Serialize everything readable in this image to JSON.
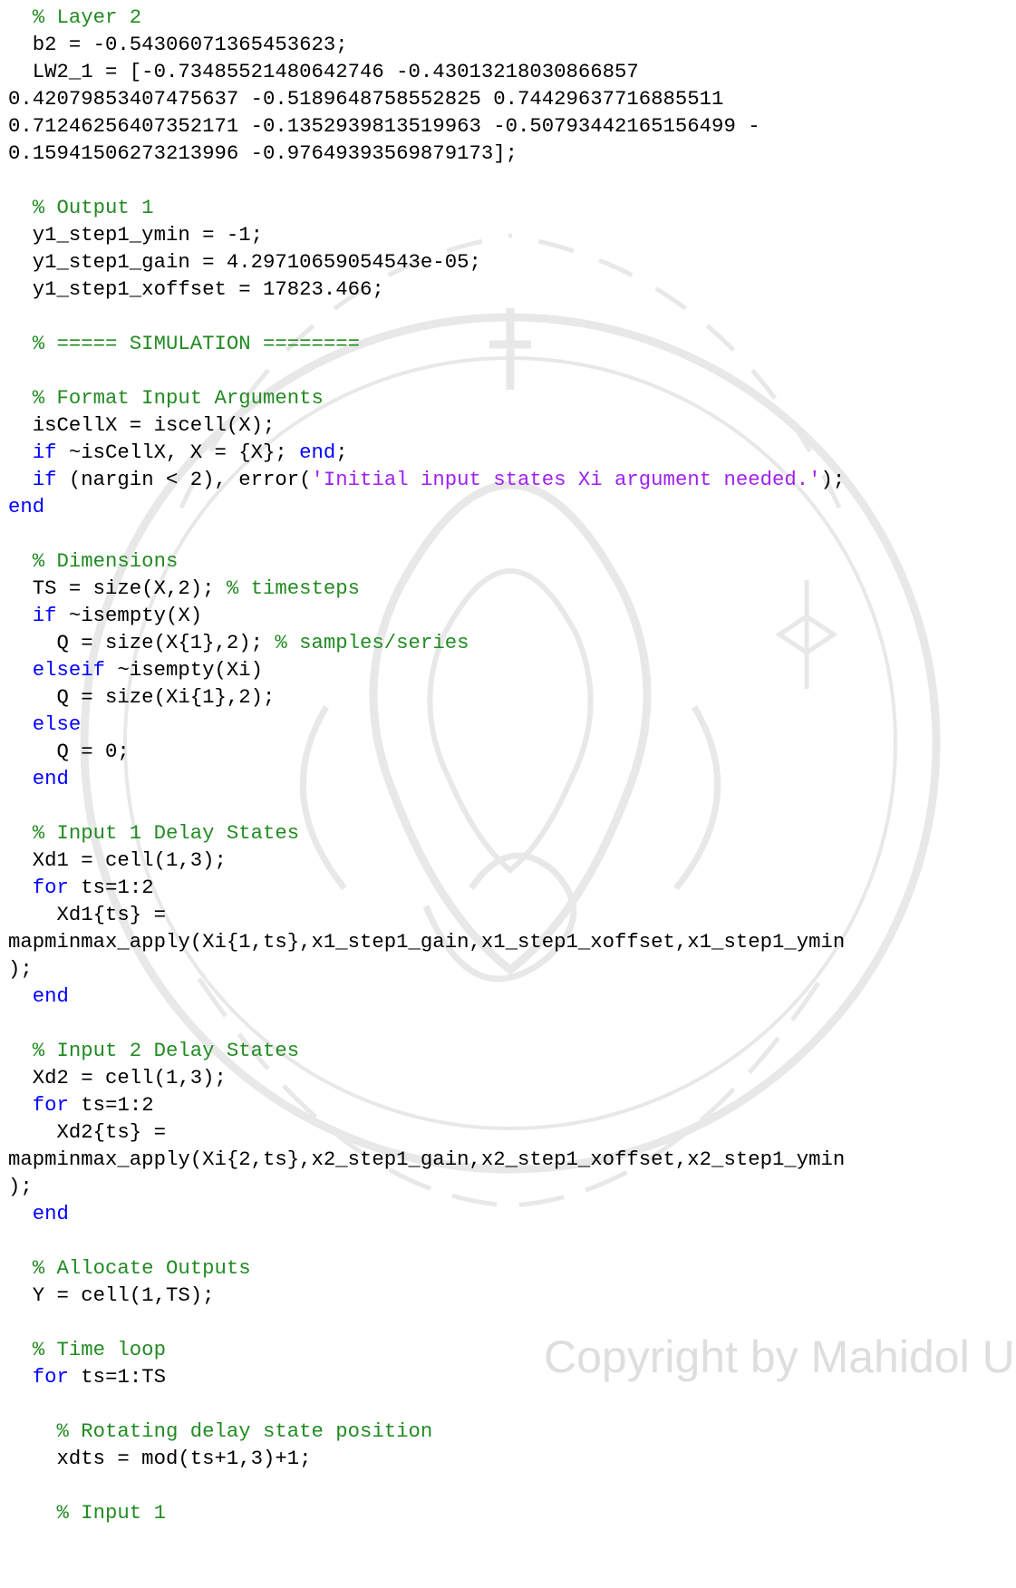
{
  "document": {
    "code_lines": [
      [
        [
          "c",
          "  % Layer 2"
        ]
      ],
      [
        [
          "p",
          "  b2 = -0.54306071365453623;"
        ]
      ],
      [
        [
          "p",
          "  LW2_1 = [-0.73485521480642746 -0.43013218030866857"
        ]
      ],
      [
        [
          "p",
          "0.42079853407475637 -0.5189648758552825 0.74429637716885511"
        ]
      ],
      [
        [
          "p",
          "0.71246256407352171 -0.1352939813519963 -0.50793442165156499 -"
        ]
      ],
      [
        [
          "p",
          "0.15941506273213996 -0.97649393569879173];"
        ]
      ],
      [],
      [
        [
          "c",
          "  % Output 1"
        ]
      ],
      [
        [
          "p",
          "  y1_step1_ymin = -1;"
        ]
      ],
      [
        [
          "p",
          "  y1_step1_gain = 4.29710659054543e-05;"
        ]
      ],
      [
        [
          "p",
          "  y1_step1_xoffset = 17823.466;"
        ]
      ],
      [],
      [
        [
          "c",
          "  % ===== SIMULATION ========"
        ]
      ],
      [],
      [
        [
          "c",
          "  % Format Input Arguments"
        ]
      ],
      [
        [
          "p",
          "  isCellX = iscell(X);"
        ]
      ],
      [
        [
          "p",
          "  "
        ],
        [
          "k",
          "if"
        ],
        [
          "p",
          " ~isCellX, X = {X}; "
        ],
        [
          "k",
          "end"
        ],
        [
          "p",
          ";"
        ]
      ],
      [
        [
          "p",
          "  "
        ],
        [
          "k",
          "if"
        ],
        [
          "p",
          " (nargin < 2), error("
        ],
        [
          "s",
          "'Initial input states Xi argument needed.'"
        ],
        [
          "p",
          ");"
        ]
      ],
      [
        [
          "k",
          "end"
        ]
      ],
      [],
      [
        [
          "c",
          "  % Dimensions"
        ]
      ],
      [
        [
          "p",
          "  TS = size(X,2); "
        ],
        [
          "c",
          "% timesteps"
        ]
      ],
      [
        [
          "p",
          "  "
        ],
        [
          "k",
          "if"
        ],
        [
          "p",
          " ~isempty(X)"
        ]
      ],
      [
        [
          "p",
          "    Q = size(X{1},2); "
        ],
        [
          "c",
          "% samples/series"
        ]
      ],
      [
        [
          "p",
          "  "
        ],
        [
          "k",
          "elseif"
        ],
        [
          "p",
          " ~isempty(Xi)"
        ]
      ],
      [
        [
          "p",
          "    Q = size(Xi{1},2);"
        ]
      ],
      [
        [
          "p",
          "  "
        ],
        [
          "k",
          "else"
        ]
      ],
      [
        [
          "p",
          "    Q = 0;"
        ]
      ],
      [
        [
          "p",
          "  "
        ],
        [
          "k",
          "end"
        ]
      ],
      [],
      [
        [
          "c",
          "  % Input 1 Delay States"
        ]
      ],
      [
        [
          "p",
          "  Xd1 = cell(1,3);"
        ]
      ],
      [
        [
          "p",
          "  "
        ],
        [
          "k",
          "for"
        ],
        [
          "p",
          " ts=1:2"
        ]
      ],
      [
        [
          "p",
          "    Xd1{ts} ="
        ]
      ],
      [
        [
          "p",
          "mapminmax_apply(Xi{1,ts},x1_step1_gain,x1_step1_xoffset,x1_step1_ymin"
        ]
      ],
      [
        [
          "p",
          ");"
        ]
      ],
      [
        [
          "p",
          "  "
        ],
        [
          "k",
          "end"
        ]
      ],
      [],
      [
        [
          "c",
          "  % Input 2 Delay States"
        ]
      ],
      [
        [
          "p",
          "  Xd2 = cell(1,3);"
        ]
      ],
      [
        [
          "p",
          "  "
        ],
        [
          "k",
          "for"
        ],
        [
          "p",
          " ts=1:2"
        ]
      ],
      [
        [
          "p",
          "    Xd2{ts} ="
        ]
      ],
      [
        [
          "p",
          "mapminmax_apply(Xi{2,ts},x2_step1_gain,x2_step1_xoffset,x2_step1_ymin"
        ]
      ],
      [
        [
          "p",
          ");"
        ]
      ],
      [
        [
          "p",
          "  "
        ],
        [
          "k",
          "end"
        ]
      ],
      [],
      [
        [
          "c",
          "  % Allocate Outputs"
        ]
      ],
      [
        [
          "p",
          "  Y = cell(1,TS);"
        ]
      ],
      [],
      [
        [
          "c",
          "  % Time loop"
        ]
      ],
      [
        [
          "p",
          "  "
        ],
        [
          "k",
          "for"
        ],
        [
          "p",
          " ts=1:TS"
        ]
      ],
      [],
      [
        [
          "c",
          "    % Rotating delay state position"
        ]
      ],
      [
        [
          "p",
          "    xdts = mod(ts+1,3)+1;"
        ]
      ],
      [],
      [
        [
          "c",
          "    % Input 1"
        ]
      ]
    ],
    "watermark_text": "Copyright by Mahidol University"
  },
  "colors": {
    "comment": "#228B22",
    "keyword": "#0000FF",
    "string": "#A020F0",
    "plain": "#000000",
    "watermark": "#dedede",
    "seal": "#e6e6e6"
  },
  "icons": [
    "university-seal-watermark-icon"
  ]
}
